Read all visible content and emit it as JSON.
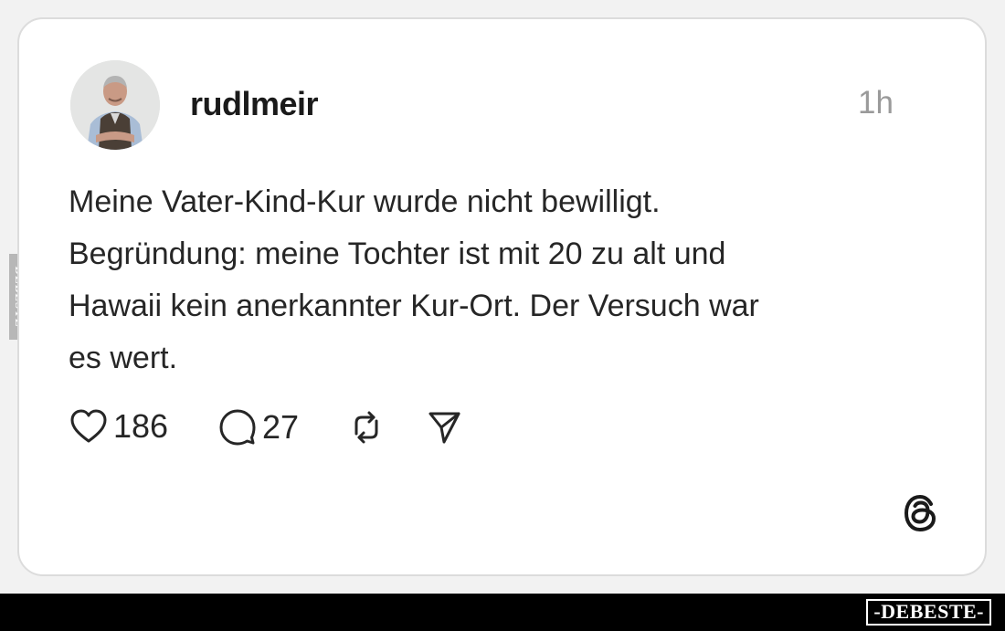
{
  "post": {
    "username": "rudlmeir",
    "timestamp": "1h",
    "text_lines": [
      "Meine Vater-Kind-Kur wurde nicht bewilligt.",
      "Begründung: meine Tochter ist mit 20 zu alt und",
      "Hawaii kein anerkannter Kur-Ort. Der Versuch war",
      "es wert."
    ],
    "likes": "186",
    "replies": "27"
  },
  "icons": {
    "avatar": "avatar-photo",
    "like": "heart-icon",
    "reply": "speech-bubble-icon",
    "repost": "repost-arrows-icon",
    "share": "send-icon",
    "brand": "threads-logo-icon"
  },
  "watermark": {
    "side": "DEBESTE",
    "badge": "-DEBESTE-"
  },
  "colors": {
    "background": "#f2f2f2",
    "card": "#ffffff",
    "text": "#262626",
    "timestamp": "#9a9a9a",
    "footer": "#000000"
  }
}
